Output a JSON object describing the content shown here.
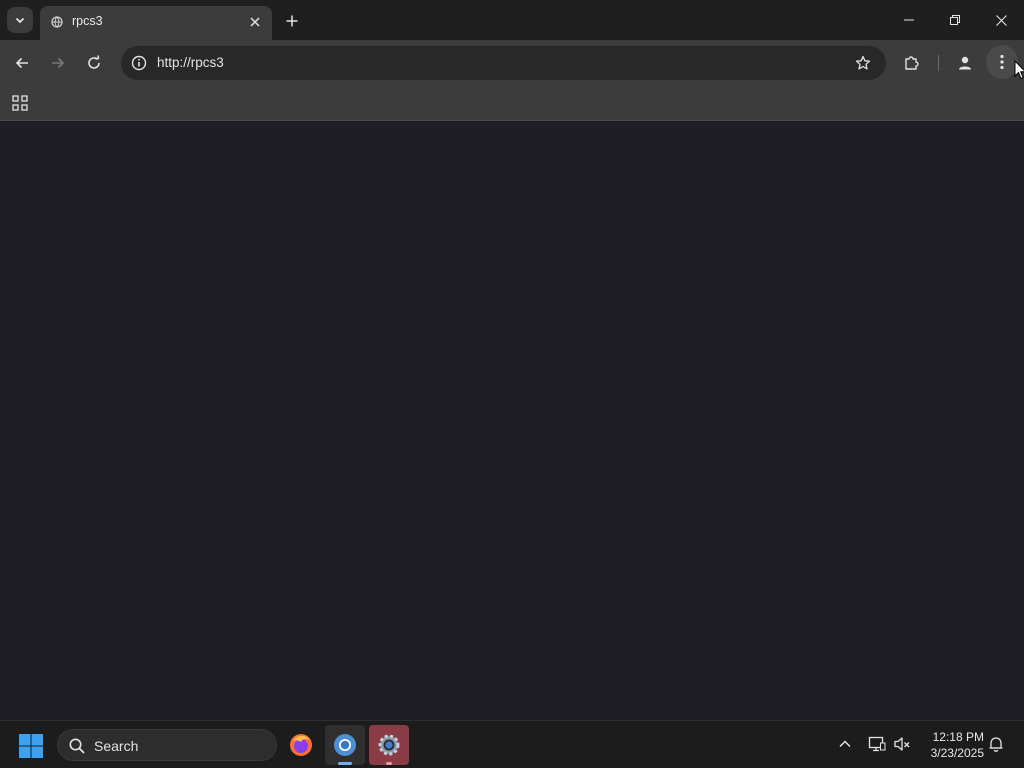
{
  "browser": {
    "tab": {
      "title": "rpcs3",
      "favicon": "globe-icon"
    },
    "omnibox": {
      "url": "http://rpcs3"
    }
  },
  "taskbar": {
    "search_label": "Search",
    "clock": {
      "time": "12:18 PM",
      "date": "3/23/2025"
    }
  },
  "colors": {
    "page_background": "#1f1e27",
    "toolbar": "#3c3c3c",
    "tabstrip": "#1f1f1f",
    "taskbar": "#1c1c1c"
  }
}
